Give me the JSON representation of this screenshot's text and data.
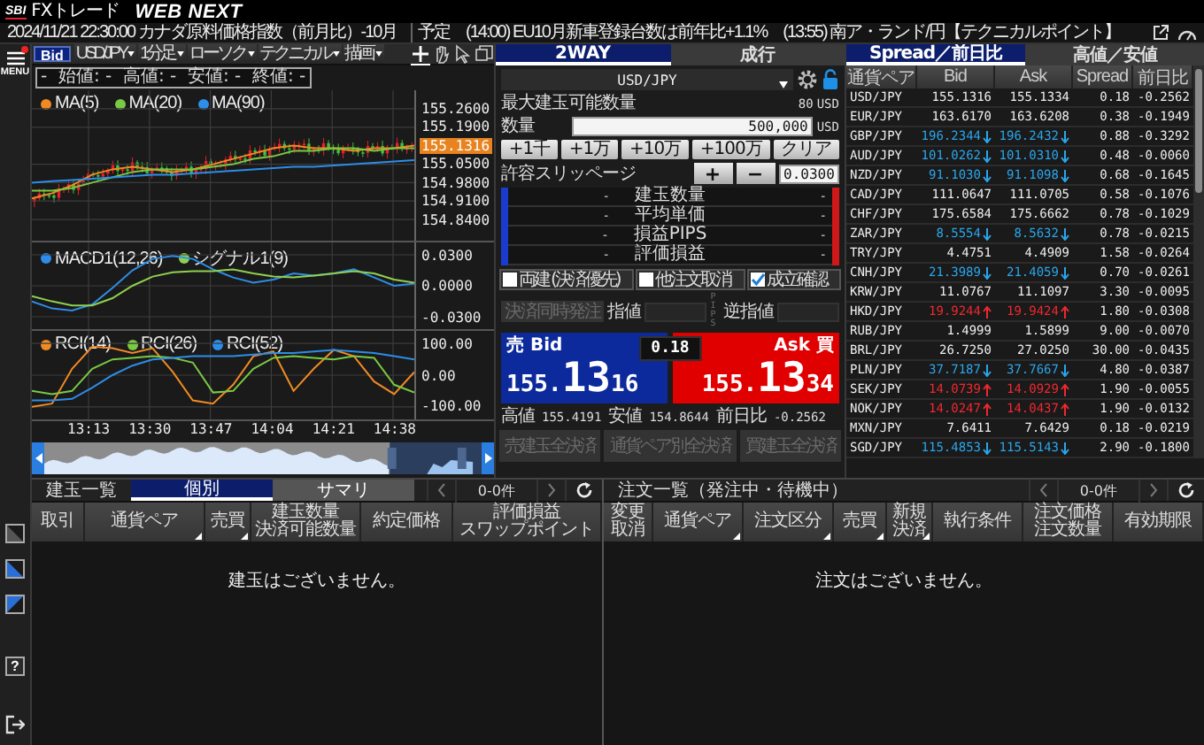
{
  "header": {
    "logo_mark": "SBI",
    "logo_text": "FXトレード",
    "product": "WEB NEXT"
  },
  "ticker": {
    "headline": "2024/11/21 22:30:00 カナダ原料価格指数（前月比）-10月",
    "label": "予定",
    "items": [
      "(14:00) EU10月新車登録台数は前年比+1.1%",
      "(13:55) 南ア・ランド/円【テクニカルポイント】"
    ]
  },
  "sidebar": {
    "menu_label": "MENU",
    "notification": true,
    "help": "?"
  },
  "chart": {
    "toolbar": [
      {
        "kind": "toggle",
        "label": "Bid"
      },
      {
        "kind": "dropdown",
        "label": "USD/JPY"
      },
      {
        "kind": "dropdown",
        "label": "1分足"
      },
      {
        "kind": "dropdown",
        "label": "ローソク"
      },
      {
        "kind": "dropdown",
        "label": "テクニカル"
      },
      {
        "kind": "dropdown",
        "label": "描画"
      }
    ],
    "tools": [
      {
        "kind": "crosshair",
        "selected": true
      },
      {
        "kind": "hand",
        "selected": false
      },
      {
        "kind": "pointer",
        "selected": false
      },
      {
        "kind": "windows",
        "selected": false
      }
    ],
    "ohlc": "-  始値: -  高値: -  安値: -  終値: -",
    "panels": [
      {
        "kind": "price",
        "chart_data": {
          "type": "line",
          "ylim": [
            154.76,
            155.33
          ],
          "series": [
            {
              "name": "MA(5)",
              "color": "#f08a24",
              "values": [
                154.92,
                154.94,
                154.97,
                155.01,
                155.03,
                155.04,
                155.03,
                155.02,
                155.03,
                155.05,
                155.07,
                155.09,
                155.11,
                155.12,
                155.11,
                155.11,
                155.1,
                155.11,
                155.11,
                155.12
              ]
            },
            {
              "name": "MA(20)",
              "color": "#7ac943",
              "values": [
                154.95,
                154.95,
                154.96,
                154.98,
                155.0,
                155.02,
                155.03,
                155.03,
                155.03,
                155.04,
                155.05,
                155.07,
                155.08,
                155.1,
                155.1,
                155.11,
                155.11,
                155.1,
                155.11,
                155.11
              ]
            },
            {
              "name": "MA(90)",
              "color": "#2d8de8",
              "values": [
                154.98,
                154.985,
                154.99,
                154.995,
                155.0,
                155.005,
                155.01,
                155.01,
                155.015,
                155.02,
                155.025,
                155.03,
                155.035,
                155.04,
                155.04,
                155.045,
                155.05,
                155.055,
                155.06,
                155.065
              ]
            }
          ],
          "yticks": [
            {
              "value": 155.26,
              "label": "155.2600"
            },
            {
              "value": 155.19,
              "label": "155.1900"
            },
            {
              "value": 155.05,
              "label": "155.0500"
            },
            {
              "value": 154.98,
              "label": "154.9800"
            },
            {
              "value": 154.91,
              "label": "154.9100"
            },
            {
              "value": 154.84,
              "label": "154.8400"
            }
          ],
          "annotations": [
            "155.1316"
          ],
          "grid": true,
          "legend": "upper left"
        }
      },
      {
        "kind": "macd",
        "chart_data": {
          "type": "line",
          "ylim": [
            -0.042,
            0.042
          ],
          "series": [
            {
              "name": "MACD1(12,26)",
              "color": "#2d8de8",
              "values": [
                -0.015,
                -0.022,
                -0.024,
                -0.018,
                -0.002,
                0.015,
                0.026,
                0.029,
                0.026,
                0.016,
                0.008,
                0.003,
                0.006,
                0.012,
                0.01,
                0.012,
                0.016,
                0.008,
                0.0,
                0.002
              ]
            },
            {
              "name": "シグナル1(9)",
              "color": "#8fd14f",
              "values": [
                -0.01,
                -0.015,
                -0.019,
                -0.019,
                -0.012,
                0.0,
                0.009,
                0.013,
                0.014,
                0.014,
                0.016,
                0.012,
                0.009,
                0.008,
                0.01,
                0.012,
                0.014,
                0.012,
                0.006,
                0.003
              ]
            }
          ],
          "yticks": [
            {
              "value": 0.03,
              "label": "0.0300"
            },
            {
              "value": 0.0,
              "label": "0.0000"
            },
            {
              "value": -0.03,
              "label": "-0.0300"
            }
          ],
          "grid": true,
          "legend": "upper left"
        }
      },
      {
        "kind": "rci",
        "chart_data": {
          "type": "line",
          "ylim": [
            -140,
            140
          ],
          "series": [
            {
              "name": "RCI(14)",
              "color": "#f08a24",
              "values": [
                -100,
                -90,
                20,
                90,
                85,
                70,
                85,
                10,
                -80,
                -90,
                -30,
                60,
                75,
                -50,
                20,
                80,
                60,
                -20,
                -60,
                10
              ]
            },
            {
              "name": "RCI(26)",
              "color": "#7ac943",
              "values": [
                -50,
                -60,
                -50,
                20,
                50,
                55,
                60,
                55,
                40,
                -55,
                -50,
                20,
                55,
                60,
                55,
                50,
                60,
                55,
                -30,
                -55
              ]
            },
            {
              "name": "RCI(52)",
              "color": "#2d8de8",
              "values": [
                -80,
                -80,
                -75,
                -40,
                0,
                30,
                50,
                55,
                60,
                60,
                60,
                65,
                70,
                70,
                75,
                80,
                75,
                70,
                60,
                50
              ]
            }
          ],
          "yticks": [
            {
              "value": 100,
              "label": "100.00"
            },
            {
              "value": 0,
              "label": "0.00"
            },
            {
              "value": -100,
              "label": "-100.00"
            }
          ],
          "grid": true,
          "legend": "upper left"
        }
      }
    ],
    "xaxis": [
      "13:13",
      "13:30",
      "13:47",
      "14:04",
      "14:21",
      "14:38"
    ]
  },
  "order": {
    "tabs": [
      {
        "label": "2WAY",
        "selected": true
      },
      {
        "label": "成行",
        "selected": false
      }
    ],
    "pair": "USD/JPY",
    "max_label": "最大建玉可能数量",
    "max_value": "80",
    "max_unit": "USD",
    "qty_label": "数量",
    "qty_value": "500,000",
    "qty_unit": "USD",
    "increments": [
      "+1千",
      "+1万",
      "+10万",
      "+100万",
      "クリア"
    ],
    "slippage_label": "許容スリッページ",
    "slippage_buttons": [
      "+",
      "−"
    ],
    "slippage_value": "0.0300",
    "positions": [
      {
        "label": "建玉数量",
        "sell": "-",
        "buy": "-"
      },
      {
        "label": "平均単価",
        "sell": "-",
        "buy": "-"
      },
      {
        "label": "損益PIPS",
        "sell": "-",
        "buy": "-"
      },
      {
        "label": "評価損益",
        "sell": "-",
        "buy": "-"
      }
    ],
    "options": [
      {
        "label": "両建",
        "note": "(決済優先)",
        "checked": false
      },
      {
        "label": "他注文取消",
        "checked": false
      },
      {
        "label": "成立確認",
        "checked": true
      }
    ],
    "settle": {
      "button": "決済同時発注",
      "limit_label": "指値",
      "pips_label": "PIPS",
      "stop_label": "逆指値",
      "disabled": true
    },
    "bid": {
      "label": "売 Bid",
      "price": "155.1316"
    },
    "spread": "0.18",
    "ask": {
      "label": "Ask 買",
      "price": "155.1334"
    },
    "stats": [
      {
        "label": "高値",
        "value": "155.4191"
      },
      {
        "label": "安値",
        "value": "154.8644"
      },
      {
        "label": "前日比",
        "value": "-0.2562"
      }
    ],
    "close_buttons": [
      {
        "label": "売建玉全決済",
        "disabled": true
      },
      {
        "label": "通貨ペア別全決済",
        "disabled": true
      },
      {
        "label": "買建玉全決済",
        "disabled": true
      }
    ]
  },
  "quotes": {
    "tabs": [
      {
        "label": "Spread／前日比",
        "selected": true
      },
      {
        "label": "高値／安値",
        "selected": false
      }
    ],
    "columns": [
      "通貨ペア",
      "Bid",
      "Ask",
      "Spread",
      "前日比"
    ],
    "rows": [
      {
        "pair": "USD/JPY",
        "bid": "155.1316",
        "ask": "155.1334",
        "spread": "0.18",
        "change": "-0.2562",
        "kind": "flat"
      },
      {
        "pair": "EUR/JPY",
        "bid": "163.6170",
        "ask": "163.6208",
        "spread": "0.38",
        "change": "-0.1949",
        "kind": "flat"
      },
      {
        "pair": "GBP/JPY",
        "bid": "196.2344",
        "ask": "196.2432",
        "spread": "0.88",
        "change": "-0.3292",
        "kind": "down"
      },
      {
        "pair": "AUD/JPY",
        "bid": "101.0262",
        "ask": "101.0310",
        "spread": "0.48",
        "change": "-0.0060",
        "kind": "down"
      },
      {
        "pair": "NZD/JPY",
        "bid": "91.1030",
        "ask": "91.1098",
        "spread": "0.68",
        "change": "-0.1645",
        "kind": "down"
      },
      {
        "pair": "CAD/JPY",
        "bid": "111.0647",
        "ask": "111.0705",
        "spread": "0.58",
        "change": "-0.1076",
        "kind": "flat"
      },
      {
        "pair": "CHF/JPY",
        "bid": "175.6584",
        "ask": "175.6662",
        "spread": "0.78",
        "change": "-0.1029",
        "kind": "flat"
      },
      {
        "pair": "ZAR/JPY",
        "bid": "8.5554",
        "ask": "8.5632",
        "spread": "0.78",
        "change": "-0.0215",
        "kind": "down"
      },
      {
        "pair": "TRY/JPY",
        "bid": "4.4751",
        "ask": "4.4909",
        "spread": "1.58",
        "change": "-0.0264",
        "kind": "flat"
      },
      {
        "pair": "CNH/JPY",
        "bid": "21.3989",
        "ask": "21.4059",
        "spread": "0.70",
        "change": "-0.0261",
        "kind": "down"
      },
      {
        "pair": "KRW/JPY",
        "bid": "11.0767",
        "ask": "11.1097",
        "spread": "3.30",
        "change": "-0.0095",
        "kind": "flat"
      },
      {
        "pair": "HKD/JPY",
        "bid": "19.9244",
        "ask": "19.9424",
        "spread": "1.80",
        "change": "-0.0308",
        "kind": "up"
      },
      {
        "pair": "RUB/JPY",
        "bid": "1.4999",
        "ask": "1.5899",
        "spread": "9.00",
        "change": "-0.0070",
        "kind": "flat"
      },
      {
        "pair": "BRL/JPY",
        "bid": "26.7250",
        "ask": "27.0250",
        "spread": "30.00",
        "change": "-0.0435",
        "kind": "flat"
      },
      {
        "pair": "PLN/JPY",
        "bid": "37.7187",
        "ask": "37.7667",
        "spread": "4.80",
        "change": "-0.0387",
        "kind": "down"
      },
      {
        "pair": "SEK/JPY",
        "bid": "14.0739",
        "ask": "14.0929",
        "spread": "1.90",
        "change": "-0.0055",
        "kind": "up"
      },
      {
        "pair": "NOK/JPY",
        "bid": "14.0247",
        "ask": "14.0437",
        "spread": "1.90",
        "change": "-0.0132",
        "kind": "up"
      },
      {
        "pair": "MXN/JPY",
        "bid": "7.6411",
        "ask": "7.6429",
        "spread": "0.18",
        "change": "-0.0219",
        "kind": "flat"
      },
      {
        "pair": "SGD/JPY",
        "bid": "115.4853",
        "ask": "115.5143",
        "spread": "2.90",
        "change": "-0.1800",
        "kind": "down"
      }
    ]
  },
  "positions": {
    "title": "建玉一覧",
    "tabs": [
      {
        "label": "個別",
        "selected": true
      },
      {
        "label": "サマリ",
        "selected": false
      }
    ],
    "count": "0-0件",
    "columns": [
      {
        "lines": [
          "取引"
        ],
        "sortable": false
      },
      {
        "lines": [
          "通貨ペア"
        ],
        "sortable": true
      },
      {
        "lines": [
          "売買"
        ],
        "sortable": true
      },
      {
        "lines": [
          "建玉数量",
          "決済可能数量"
        ],
        "sortable": false
      },
      {
        "lines": [
          "約定価格"
        ],
        "sortable": false
      },
      {
        "lines": [
          "評価損益",
          "スワップポイント"
        ],
        "sortable": false
      }
    ],
    "empty": "建玉はございません。"
  },
  "orders": {
    "title": "注文一覧（発注中・待機中）",
    "count": "0-0件",
    "columns": [
      {
        "lines": [
          "変更",
          "取消"
        ],
        "sortable": false
      },
      {
        "lines": [
          "通貨ペア"
        ],
        "sortable": true
      },
      {
        "lines": [
          "注文区分"
        ],
        "sortable": true
      },
      {
        "lines": [
          "売買"
        ],
        "sortable": true
      },
      {
        "lines": [
          "新規",
          "決済"
        ],
        "sortable": true
      },
      {
        "lines": [
          "執行条件"
        ],
        "sortable": false
      },
      {
        "lines": [
          "注文価格",
          "注文数量"
        ],
        "sortable": false
      },
      {
        "lines": [
          "有効期限"
        ],
        "sortable": false
      }
    ],
    "empty": "注文はございません。"
  }
}
